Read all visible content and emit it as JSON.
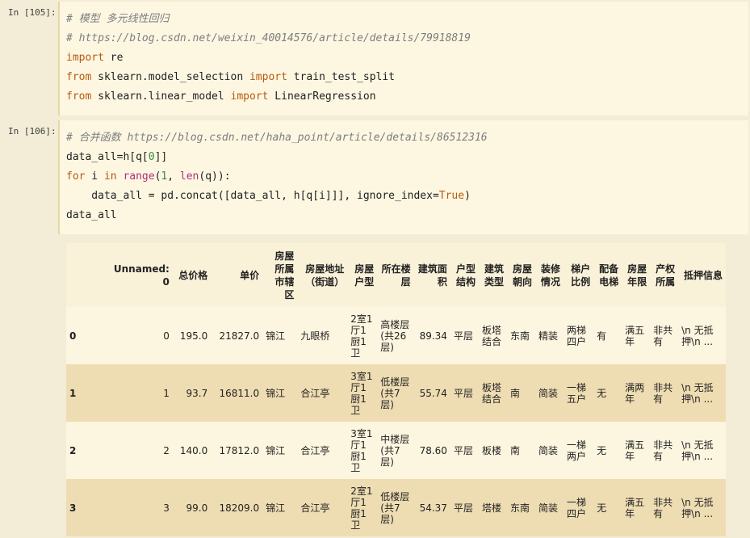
{
  "cells": [
    {
      "prompt": "In [105]:",
      "lines": [
        [
          {
            "t": "# 模型 多元线性回归",
            "c": "cm"
          }
        ],
        [
          {
            "t": "# https://blog.csdn.net/weixin_40014576/article/details/79918819",
            "c": "cm"
          }
        ],
        [
          {
            "t": "import",
            "c": "kw"
          },
          {
            "t": " re",
            "c": ""
          }
        ],
        [
          {
            "t": "from",
            "c": "kw"
          },
          {
            "t": " sklearn.model_selection ",
            "c": ""
          },
          {
            "t": "import",
            "c": "kw"
          },
          {
            "t": " train_test_split",
            "c": ""
          }
        ],
        [
          {
            "t": "from",
            "c": "kw"
          },
          {
            "t": " sklearn.linear_model ",
            "c": ""
          },
          {
            "t": "import",
            "c": "kw"
          },
          {
            "t": " LinearRegression",
            "c": ""
          }
        ]
      ]
    },
    {
      "prompt": "In [106]:",
      "lines": [
        [
          {
            "t": "# 合并函数 https://blog.csdn.net/haha_point/article/details/86512316",
            "c": "cm"
          }
        ],
        [
          {
            "t": "data_all=h[q[",
            "c": ""
          },
          {
            "t": "0",
            "c": "num"
          },
          {
            "t": "]]",
            "c": ""
          }
        ],
        [
          {
            "t": "for",
            "c": "kw"
          },
          {
            "t": " i ",
            "c": ""
          },
          {
            "t": "in",
            "c": "kw"
          },
          {
            "t": " ",
            "c": ""
          },
          {
            "t": "range",
            "c": "bi"
          },
          {
            "t": "(",
            "c": ""
          },
          {
            "t": "1",
            "c": "num"
          },
          {
            "t": ", ",
            "c": ""
          },
          {
            "t": "len",
            "c": "bi"
          },
          {
            "t": "(q)):",
            "c": ""
          }
        ],
        [
          {
            "t": "    data_all = pd.concat([data_all, h[q[i]]], ignore_index=",
            "c": ""
          },
          {
            "t": "True",
            "c": "kw"
          },
          {
            "t": ")",
            "c": ""
          }
        ],
        [
          {
            "t": "data_all",
            "c": ""
          }
        ]
      ]
    }
  ],
  "table": {
    "columns": [
      {
        "label": "",
        "align": "left"
      },
      {
        "label": "Unnamed: 0",
        "align": "right"
      },
      {
        "label": "总价格",
        "align": "right"
      },
      {
        "label": "单价",
        "align": "right"
      },
      {
        "label": "房屋所属市辖区",
        "align": "right"
      },
      {
        "label": "房屋地址（街道）",
        "align": "right"
      },
      {
        "label": "房屋户型",
        "align": "right"
      },
      {
        "label": "所在楼层",
        "align": "right"
      },
      {
        "label": "建筑面积",
        "align": "right"
      },
      {
        "label": "户型结构",
        "align": "right"
      },
      {
        "label": "建筑类型",
        "align": "right"
      },
      {
        "label": "房屋朝向",
        "align": "right"
      },
      {
        "label": "装修情况",
        "align": "right"
      },
      {
        "label": "梯户比例",
        "align": "right"
      },
      {
        "label": "配备电梯",
        "align": "right"
      },
      {
        "label": "房屋年限",
        "align": "right"
      },
      {
        "label": "产权所属",
        "align": "right"
      },
      {
        "label": "抵押信息",
        "align": "right"
      }
    ],
    "rows": [
      [
        "0",
        "0",
        "195.0",
        "21827.0",
        "锦江",
        "九眼桥",
        "2室1厅1厨1卫",
        "高楼层 (共26层)",
        "89.34",
        "平层",
        "板塔结合",
        "东南",
        "精装",
        "两梯四户",
        "有",
        "满五年",
        "非共有",
        "\\n 无抵押\\n ..."
      ],
      [
        "1",
        "1",
        "93.7",
        "16811.0",
        "锦江",
        "合江亭",
        "3室1厅1厨1卫",
        "低楼层 (共7层)",
        "55.74",
        "平层",
        "板塔结合",
        "南",
        "简装",
        "一梯五户",
        "无",
        "满两年",
        "非共有",
        "\\n 无抵押\\n ..."
      ],
      [
        "2",
        "2",
        "140.0",
        "17812.0",
        "锦江",
        "合江亭",
        "3室1厅1厨1卫",
        "中楼层 (共7层)",
        "78.60",
        "平层",
        "板楼",
        "南",
        "简装",
        "一梯两户",
        "无",
        "满五年",
        "非共有",
        "\\n 无抵押\\n ..."
      ],
      [
        "3",
        "3",
        "99.0",
        "18209.0",
        "锦江",
        "合江亭",
        "2室1厅1厨1卫",
        "低楼层 (共7层)",
        "54.37",
        "平层",
        "塔楼",
        "东南",
        "简装",
        "一梯四户",
        "无",
        "满五年",
        "非共有",
        "\\n 无抵押\\n ..."
      ]
    ]
  }
}
